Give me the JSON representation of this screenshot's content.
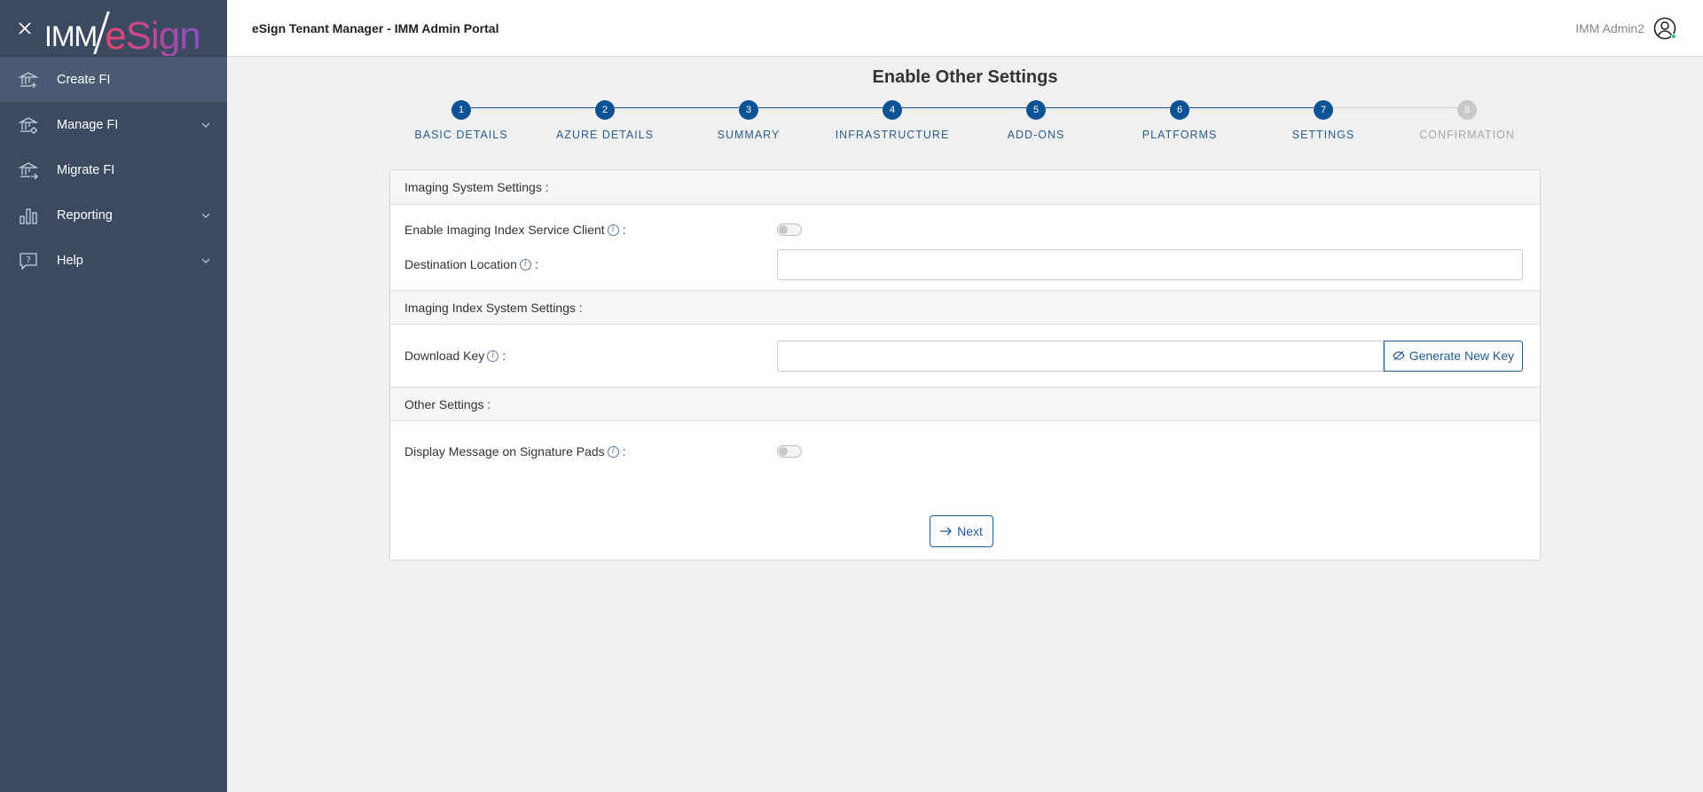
{
  "app": {
    "logo_part1": "IMM",
    "logo_part2": "eSign",
    "portal_title": "eSign Tenant Manager - IMM Admin Portal",
    "user_name": "IMM Admin2"
  },
  "sidebar": {
    "items": [
      {
        "label": "Create FI",
        "icon": "bank-add-icon",
        "active": true,
        "expandable": false
      },
      {
        "label": "Manage FI",
        "icon": "bank-settings-icon",
        "active": false,
        "expandable": true
      },
      {
        "label": "Migrate FI",
        "icon": "bank-migrate-icon",
        "active": false,
        "expandable": false
      },
      {
        "label": "Reporting",
        "icon": "bar-chart-icon",
        "active": false,
        "expandable": true
      },
      {
        "label": "Help",
        "icon": "help-icon",
        "active": false,
        "expandable": true
      }
    ]
  },
  "page": {
    "title": "Enable Other Settings"
  },
  "stepper": {
    "steps": [
      {
        "number": "1",
        "label": "BASIC DETAILS",
        "state": "done"
      },
      {
        "number": "2",
        "label": "AZURE DETAILS",
        "state": "done"
      },
      {
        "number": "3",
        "label": "SUMMARY",
        "state": "done"
      },
      {
        "number": "4",
        "label": "INFRASTRUCTURE",
        "state": "done"
      },
      {
        "number": "5",
        "label": "ADD-ONS",
        "state": "done"
      },
      {
        "number": "6",
        "label": "PLATFORMS",
        "state": "done"
      },
      {
        "number": "7",
        "label": "SETTINGS",
        "state": "current"
      },
      {
        "number": "8",
        "label": "CONFIRMATION",
        "state": "pending"
      }
    ]
  },
  "form": {
    "imaging_system": {
      "header": "Imaging System Settings :",
      "enable_client_label": "Enable Imaging Index Service Client",
      "enable_client_value": false,
      "destination_label": "Destination Location",
      "destination_value": ""
    },
    "imaging_index": {
      "header": "Imaging Index System Settings :",
      "download_key_label": "Download Key",
      "download_key_value": "",
      "generate_button": "Generate New Key"
    },
    "other": {
      "header": "Other Settings :",
      "display_message_label": "Display Message on Signature Pads",
      "display_message_value": false
    },
    "colon": ":",
    "info_glyph": "i",
    "next_button": "Next"
  },
  "colors": {
    "sidebar_bg": "#3b4a60",
    "accent": "#1f5b97",
    "step_active": "#0b5394",
    "step_pending": "#c8c8c8"
  }
}
